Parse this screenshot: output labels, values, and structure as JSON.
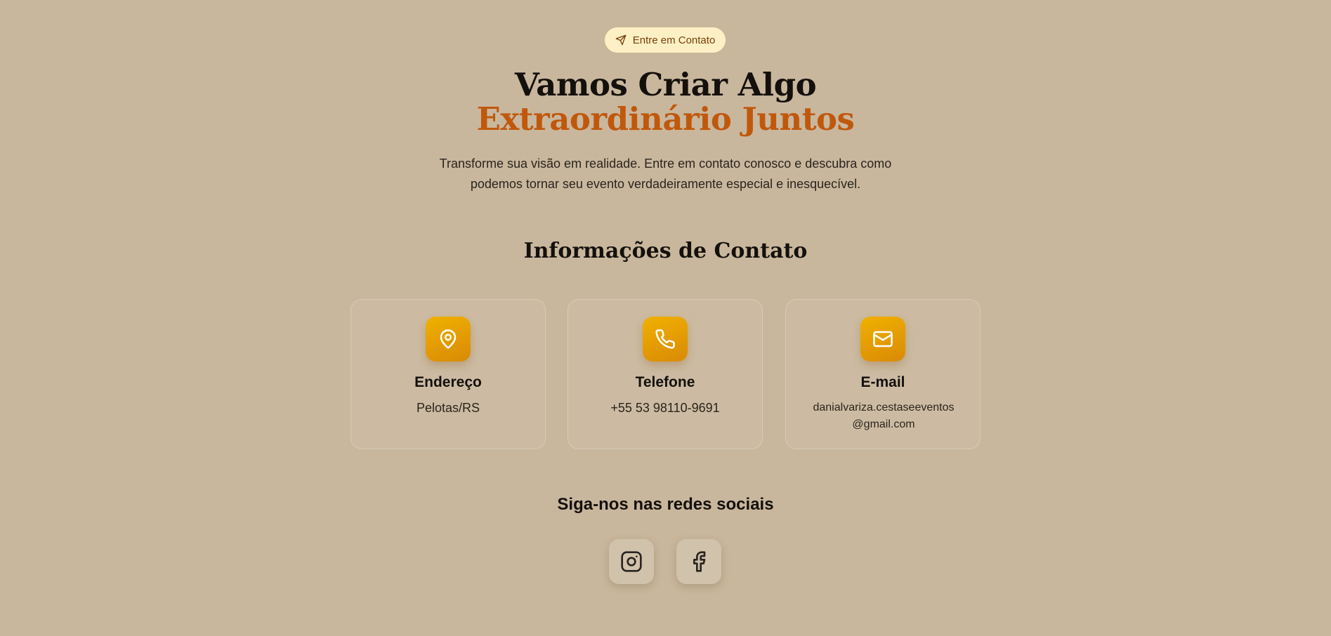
{
  "badge": {
    "label": "Entre em Contato",
    "icon": "send-icon"
  },
  "hero": {
    "title_line1": "Vamos Criar Algo",
    "title_line2": "Extraordinário Juntos",
    "subtitle": "Transforme sua visão em realidade. Entre em contato conosco e descubra como podemos tornar seu evento verdadeiramente especial e inesquecível."
  },
  "contact": {
    "heading": "Informações de Contato",
    "cards": [
      {
        "icon": "map-pin-icon",
        "title": "Endereço",
        "value": "Pelotas/RS"
      },
      {
        "icon": "phone-icon",
        "title": "Telefone",
        "value": "+55 53 98110-9691"
      },
      {
        "icon": "mail-icon",
        "title": "E-mail",
        "value": "danialvariza.cestaseeventos@gmail.com"
      }
    ]
  },
  "social": {
    "heading": "Siga-nos nas redes sociais",
    "links": [
      {
        "icon": "instagram-icon"
      },
      {
        "icon": "facebook-icon"
      }
    ]
  },
  "colors": {
    "background": "#c9b79d",
    "accent": "#c0580c",
    "icon_gradient_start": "#f0b100",
    "icon_gradient_end": "#d98a06",
    "badge_bg": "#fdf0c4"
  }
}
